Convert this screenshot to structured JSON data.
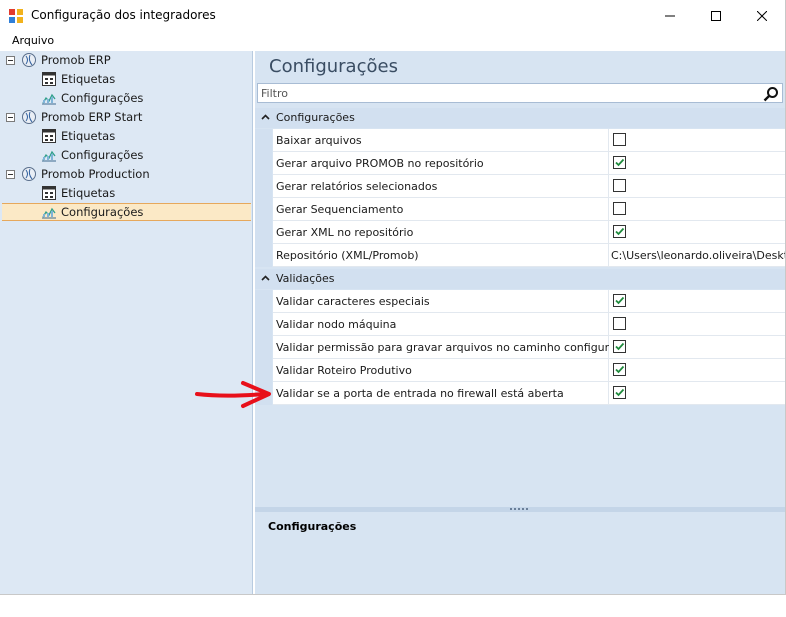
{
  "window": {
    "title": "Configuração dos integradores",
    "controls": {
      "minimize": "minimize",
      "maximize": "maximize",
      "close": "close"
    }
  },
  "menu": {
    "items": [
      {
        "label": "Arquivo"
      }
    ]
  },
  "tree": {
    "groups": [
      {
        "label": "Promob ERP",
        "children": [
          {
            "label": "Etiquetas"
          },
          {
            "label": "Configurações"
          }
        ]
      },
      {
        "label": "Promob ERP Start",
        "children": [
          {
            "label": "Etiquetas"
          },
          {
            "label": "Configurações"
          }
        ]
      },
      {
        "label": "Promob Production",
        "children": [
          {
            "label": "Etiquetas"
          },
          {
            "label": "Configurações",
            "selected": true
          }
        ]
      }
    ]
  },
  "main": {
    "title": "Configurações",
    "filter": {
      "placeholder": "Filtro",
      "value": ""
    },
    "categories": [
      {
        "label": "Configurações",
        "rows": [
          {
            "name": "Baixar arquivos",
            "checked": false
          },
          {
            "name": "Gerar arquivo PROMOB no repositório",
            "checked": true
          },
          {
            "name": "Gerar relatórios selecionados",
            "checked": false
          },
          {
            "name": "Gerar Sequenciamento",
            "checked": false
          },
          {
            "name": "Gerar XML no repositório",
            "checked": true
          },
          {
            "name": "Repositório (XML/Promob)",
            "text": "C:\\Users\\leonardo.oliveira\\Deskto"
          }
        ]
      },
      {
        "label": "Validações",
        "rows": [
          {
            "name": "Validar caracteres especiais",
            "checked": true
          },
          {
            "name": "Validar nodo máquina",
            "checked": false
          },
          {
            "name": "Validar permissão para gravar arquivos no caminho configurado",
            "checked": true
          },
          {
            "name": "Validar Roteiro Produtivo",
            "checked": true
          },
          {
            "name": "Validar se a porta de entrada no firewall está aberta",
            "checked": true
          }
        ]
      }
    ],
    "description": {
      "title": "Configurações"
    }
  },
  "colors": {
    "accent": "#d7e4f2",
    "selection": "#fbe9c6",
    "check": "#1e8a3c",
    "annotation_arrow": "#e8101a"
  },
  "icons": {
    "app": "app-icon",
    "root": "globe-node-icon",
    "etiquetas": "label-sheet-icon",
    "configuracoes": "chart-config-icon",
    "search": "search-icon"
  }
}
